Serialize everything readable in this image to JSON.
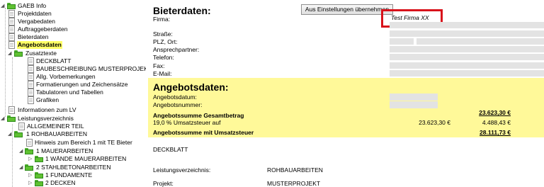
{
  "tree": {
    "root": "GAEB Info",
    "projektdaten": "Projektdaten",
    "vergabedaten": "Vergabedaten",
    "auftraggeberdaten": "Auftraggeberdaten",
    "bieterdaten": "Bieterdaten",
    "angebotsdaten": "Angebotsdaten",
    "zusatztexte": "Zusatztexte",
    "deckblatt": "DECKBLATT",
    "baubeschreibung": "BAUBESCHREIBUNG MUSTERPROJEKT",
    "vorbemerkungen": "Allg. Vorbemerkungen",
    "formatierungen": "Formatierungen und Zeichensätze",
    "tabulatoren": "Tabulatoren und Tabellen",
    "grafiken": "Grafiken",
    "informationen_lv": "Informationen zum LV",
    "leistungsverzeichnis": "Leistungsverzeichnis",
    "allgemeiner_teil": "ALLGEMEINER TEIL",
    "rohbau": "1 ROHBAUARBEITEN",
    "hinweis": "Hinweis zum Bereich 1 mit TE Bieter",
    "mauer": "1 MAUERARBEITEN",
    "waende": "1 WÄNDE MAUERARBEITEN",
    "stahlbeton": "2 STAHLBETONARBEITEN",
    "fundamente": "1 FUNDAMENTE",
    "decken": "2 DECKEN"
  },
  "bieter": {
    "title": "Bieterdaten:",
    "button_label": "Aus Einstellungen übernehmen",
    "firma_label": "Firma:",
    "firma_value": "Test Firma XX",
    "strasse_label": "Straße:",
    "plz_label": "PLZ, Ort:",
    "ansprech_label": "Ansprechpartner:",
    "telefon_label": "Telefon:",
    "fax_label": "Fax:",
    "email_label": "E-Mail:"
  },
  "angebot": {
    "title": "Angebotsdaten:",
    "datum_label": "Angebotsdatum:",
    "nummer_label": "Angebotsnummer:",
    "gesamt_label": "Angebotssumme Gesamtbetrag",
    "gesamt_value": "23.623,30 €",
    "ust_label": "19,0 % Umsatzsteuer auf",
    "ust_base": "23.623,30 €",
    "ust_value": "4.488,43 €",
    "mit_ust_label": "Angebotssumme mit Umsatzsteuer",
    "mit_ust_value": "28.111,73 €"
  },
  "lower": {
    "deckblatt": "DECKBLATT",
    "lv_label": "Leistungsverzeichnis:",
    "lv_value": "ROHBAUARBEITEN",
    "projekt_label": "Projekt:",
    "projekt_value": "MUSTERPROJEKT"
  },
  "colors": {
    "folder": "#5fc132",
    "highlight": "#ffff66",
    "offer_background": "#fff999",
    "red_box": "#d8121b"
  }
}
